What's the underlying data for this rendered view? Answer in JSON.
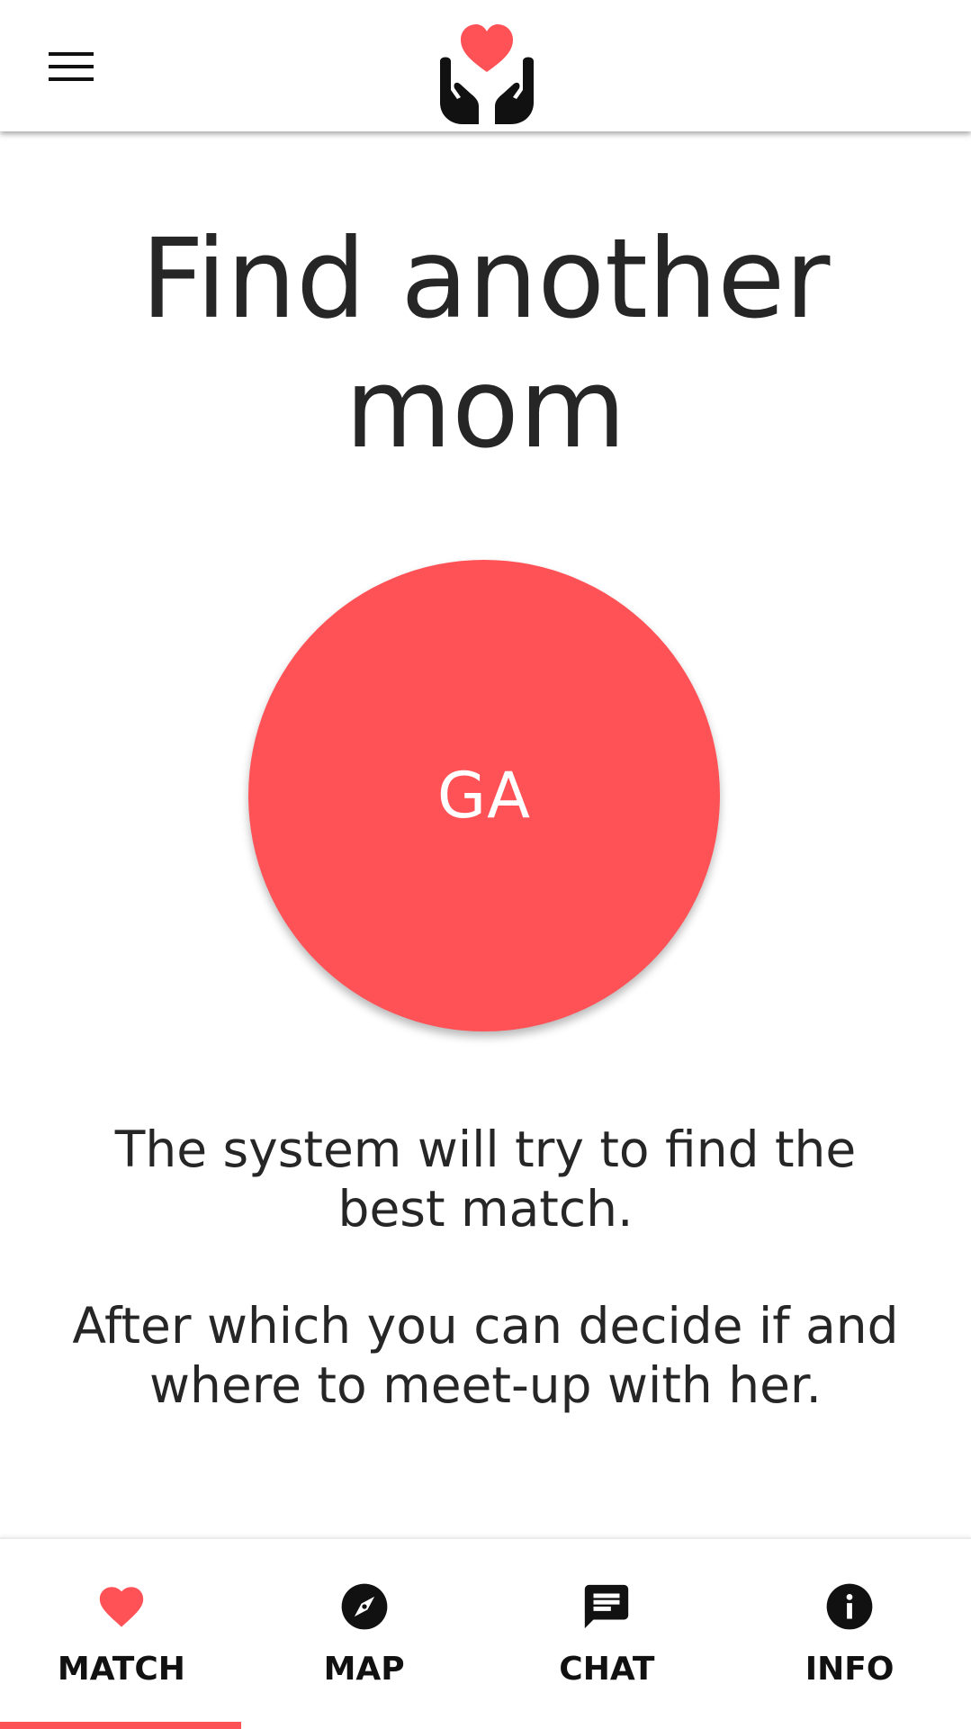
{
  "colors": {
    "accent": "#ff5257",
    "text": "#262626",
    "icon": "#111111"
  },
  "header": {
    "menu_icon": "hamburger-menu-icon",
    "logo_icon": "hands-holding-heart-icon"
  },
  "main": {
    "title": "Find another mom",
    "match_button_label": "GA",
    "description_1": "The system will try to find the best match.",
    "description_2": "After which you can decide if and where to meet-up with her."
  },
  "bottom_nav": {
    "active_tab": "MATCH",
    "tabs": [
      {
        "label": "MATCH",
        "icon": "heart-icon"
      },
      {
        "label": "MAP",
        "icon": "compass-icon"
      },
      {
        "label": "CHAT",
        "icon": "chat-bubble-icon"
      },
      {
        "label": "INFO",
        "icon": "info-icon"
      }
    ]
  }
}
